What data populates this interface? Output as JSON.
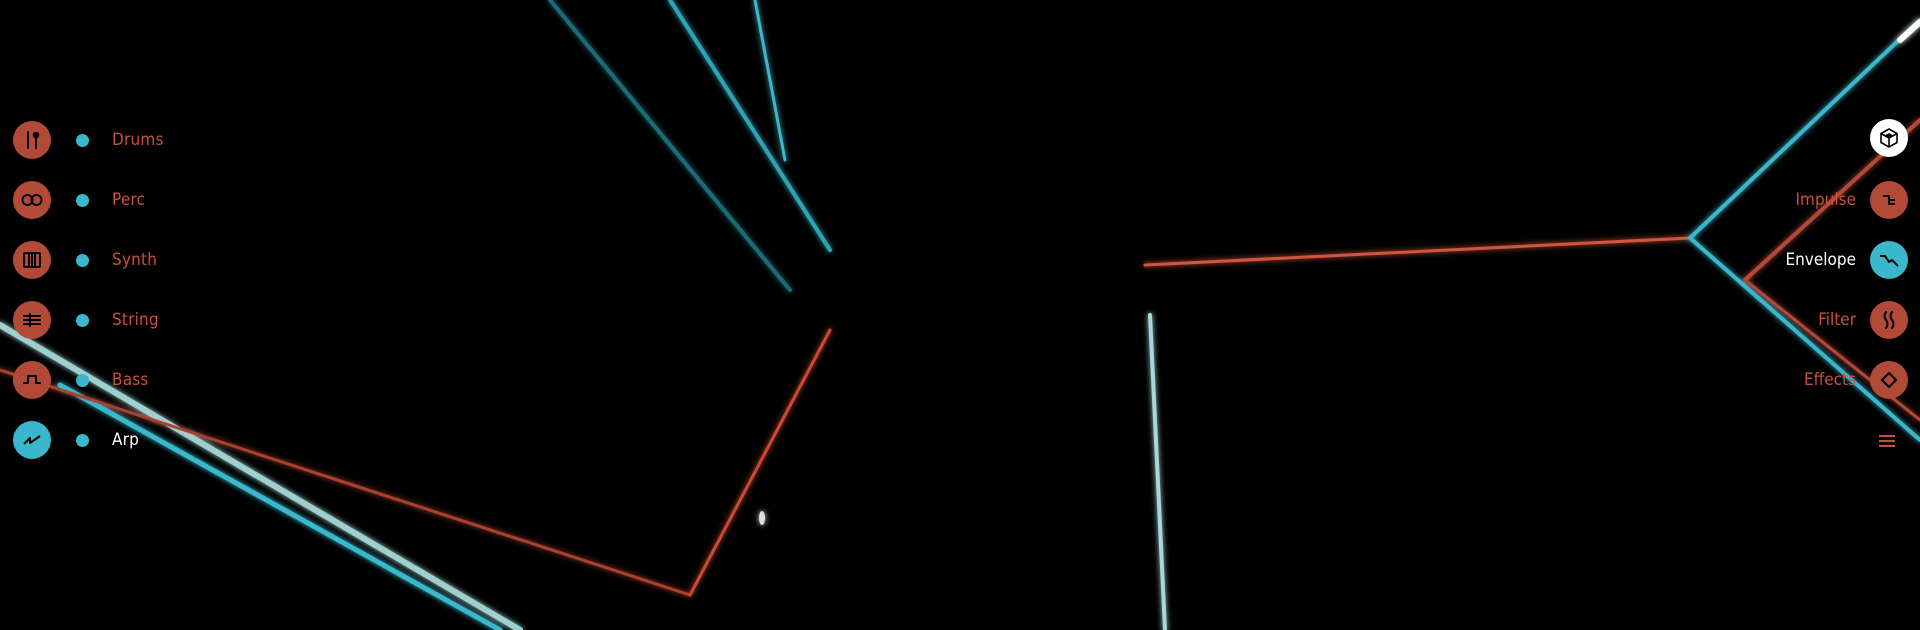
{
  "instruments": [
    {
      "label": "Drums",
      "icon": "drumsticks-icon",
      "active": false
    },
    {
      "label": "Perc",
      "icon": "shaker-icon",
      "active": false
    },
    {
      "label": "Synth",
      "icon": "keyboard-icon",
      "active": false
    },
    {
      "label": "String",
      "icon": "strings-icon",
      "active": false
    },
    {
      "label": "Bass",
      "icon": "square-wave-icon",
      "active": false
    },
    {
      "label": "Arp",
      "icon": "arp-wave-icon",
      "active": true
    }
  ],
  "modules": [
    {
      "label": "",
      "icon": "cube-icon",
      "active": false
    },
    {
      "label": "Impulse",
      "icon": "impulse-icon",
      "active": false
    },
    {
      "label": "Envelope",
      "icon": "envelope-icon",
      "active": true
    },
    {
      "label": "Filter",
      "icon": "filter-icon",
      "active": false
    },
    {
      "label": "Effects",
      "icon": "diamond-icon",
      "active": false
    }
  ],
  "menu_icon": "hamburger-menu-icon",
  "colors": {
    "accent_red": "#b24a38",
    "accent_cyan": "#3ab7cc",
    "label_red": "#c9503c",
    "background": "#000000"
  }
}
